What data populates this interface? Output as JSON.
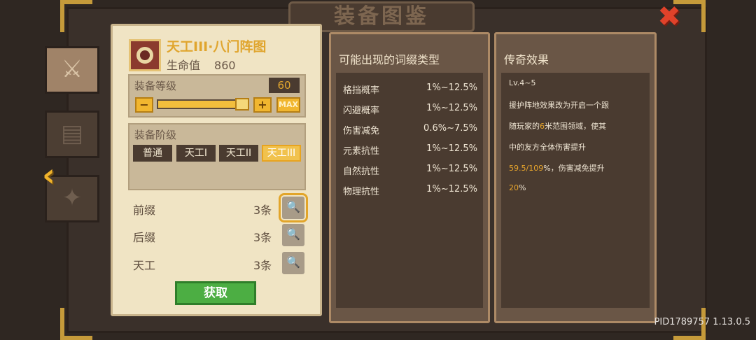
{
  "window": {
    "title": "装备图鉴",
    "version_label": "PID1789757 1.13.0.5"
  },
  "item": {
    "name": "天工III·八门阵图",
    "stat_label": "生命值",
    "stat_value": "860"
  },
  "level": {
    "label": "装备等级",
    "value": "60",
    "minus": "−",
    "plus": "+",
    "max": "MAX",
    "fraction": 1.0
  },
  "tier": {
    "label": "装备阶级",
    "options": [
      "普通",
      "天工I",
      "天工II",
      "天工III"
    ],
    "selected": "天工III"
  },
  "affixes": [
    {
      "label": "前缀",
      "count": "3条"
    },
    {
      "label": "后缀",
      "count": "3条"
    },
    {
      "label": "天工",
      "count": "3条"
    }
  ],
  "acquire_label": "获取",
  "possible_affixes": {
    "title": "可能出现的词缀类型",
    "rows": [
      {
        "name": "格挡概率",
        "range": "1%~12.5%"
      },
      {
        "name": "闪避概率",
        "range": "1%~12.5%"
      },
      {
        "name": "伤害减免",
        "range": "0.6%~7.5%"
      },
      {
        "name": "元素抗性",
        "range": "1%~12.5%"
      },
      {
        "name": "自然抗性",
        "range": "1%~12.5%"
      },
      {
        "name": "物理抗性",
        "range": "1%~12.5%"
      }
    ]
  },
  "legend": {
    "title": "传奇效果",
    "level_range": "Lv.4~5",
    "line1": "援护阵地效果改为开启一个跟",
    "line2_a": "随玩家的",
    "line2_hl": "6",
    "line2_b": "米范围领域，使其",
    "line3": "中的友方全体伤害提升",
    "line4_hl": "59.5/109",
    "line4_b": "%，伤害减免提升",
    "line5_hl": "20",
    "line5_b": "%"
  },
  "colors": {
    "accent": "#e0a52e",
    "close": "#e0422a",
    "acquire": "#4cae43"
  }
}
